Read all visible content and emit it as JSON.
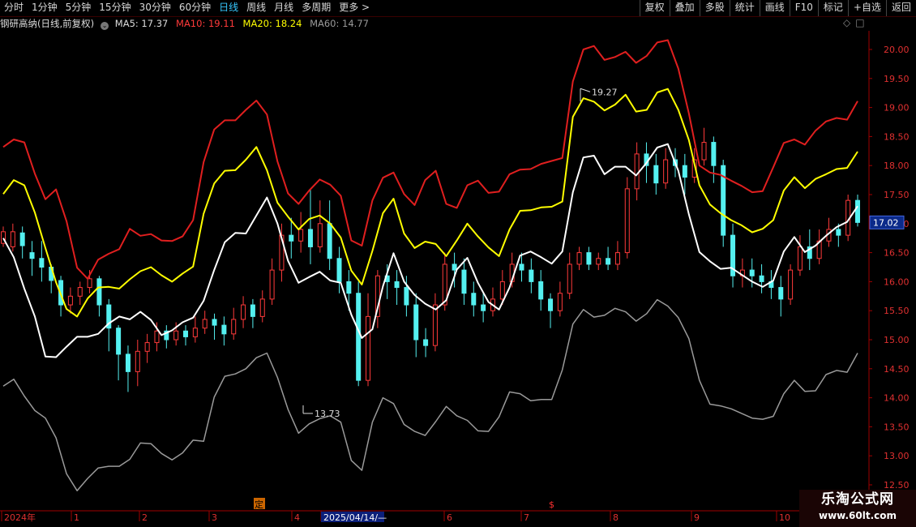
{
  "toolbar": {
    "periods": [
      "分时",
      "1分钟",
      "5分钟",
      "15分钟",
      "30分钟",
      "60分钟",
      "日线",
      "周线",
      "月线",
      "多周期",
      "更多 >"
    ],
    "active_period": "日线",
    "actions": [
      "复权",
      "叠加",
      "多股",
      "统计",
      "画线",
      "F10",
      "标记",
      "+自选",
      "返回"
    ]
  },
  "legend": {
    "stock": "钢研高纳(日线,前复权)",
    "ma5": "MA5: 17.37",
    "ma10": "MA10: 19.11",
    "ma20": "MA20: 18.24",
    "ma60": "MA60: 14.77",
    "icons": [
      "diamond-icon",
      "square-icon"
    ]
  },
  "annotations": {
    "high": "19.27",
    "low": "13.73",
    "last_price": "17.02",
    "event_ding": "定",
    "event_s": "$"
  },
  "watermark": {
    "title": "乐淘公式网",
    "url": "www.60lt.com"
  },
  "colors": {
    "up": "#ff3a3a",
    "down": "#54f0f0",
    "ma5": "#ffffff",
    "ma10": "#e01f1f",
    "ma20": "#ffff00",
    "ma60": "#9a9a9a",
    "axis": "#a00000",
    "active_tab": "#37c8ff"
  },
  "chart_data": {
    "type": "candlestick",
    "y_ticks": [
      "20.00",
      "19.50",
      "19.00",
      "18.50",
      "18.00",
      "17.50",
      "17.00",
      "16.50",
      "16.00",
      "15.50",
      "15.00",
      "14.50",
      "14.00",
      "13.50",
      "13.00",
      "12.50"
    ],
    "ylim": [
      12.5,
      20.4
    ],
    "x_ticks": [
      "2024年",
      "1",
      "2",
      "3",
      "4",
      "2025/04/14/—",
      "6",
      "7",
      "8",
      "9",
      "10"
    ],
    "series": [
      {
        "name": "MA5",
        "style": "white-line",
        "values": [
          16.75,
          16.42,
          15.88,
          15.4,
          14.71,
          14.7,
          14.88,
          15.05,
          15.05,
          15.1,
          15.28,
          15.4,
          15.35,
          15.48,
          15.34,
          15.08,
          15.16,
          15.3,
          15.38,
          15.67,
          16.2,
          16.68,
          16.84,
          16.83,
          17.14,
          17.45,
          17.0,
          16.36,
          15.98,
          16.08,
          16.17,
          16.02,
          15.98,
          15.43,
          15.03,
          15.18,
          15.92,
          16.49,
          16.0,
          15.77,
          15.62,
          15.52,
          15.68,
          16.21,
          16.41,
          15.98,
          15.65,
          15.52,
          15.9,
          16.45,
          16.52,
          16.42,
          16.31,
          16.52,
          17.54,
          18.14,
          18.17,
          17.85,
          17.98,
          17.98,
          17.83,
          18.05,
          18.31,
          18.37,
          17.91,
          17.16,
          16.51,
          16.35,
          16.22,
          16.24,
          16.12,
          16.0,
          15.91,
          16.02,
          16.52,
          16.77,
          16.51,
          16.62,
          16.79,
          16.94,
          17.03,
          17.3
        ]
      },
      {
        "name": "MA10",
        "style": "red-line",
        "values": [
          18.32,
          18.45,
          18.4,
          17.86,
          17.42,
          17.59,
          17.04,
          16.24,
          16.05,
          16.38,
          16.48,
          16.56,
          16.91,
          16.79,
          16.82,
          16.71,
          16.7,
          16.78,
          17.06,
          18.06,
          18.62,
          18.78,
          18.78,
          18.96,
          19.12,
          18.88,
          18.07,
          17.52,
          17.34,
          17.57,
          17.76,
          17.67,
          17.48,
          16.71,
          16.62,
          17.4,
          17.79,
          17.88,
          17.51,
          17.32,
          17.75,
          17.91,
          17.34,
          17.27,
          17.66,
          17.74,
          17.53,
          17.55,
          17.85,
          17.93,
          17.94,
          18.03,
          18.08,
          18.13,
          19.45,
          20.0,
          20.06,
          19.82,
          19.87,
          19.96,
          19.77,
          19.89,
          20.12,
          20.16,
          19.67,
          18.9,
          18.0,
          17.88,
          17.84,
          17.74,
          17.65,
          17.54,
          17.56,
          17.97,
          18.39,
          18.45,
          18.36,
          18.6,
          18.76,
          18.82,
          18.79,
          19.11
        ]
      },
      {
        "name": "MA20",
        "style": "yellow-line",
        "values": [
          17.51,
          17.75,
          17.66,
          17.19,
          16.58,
          15.99,
          15.53,
          15.4,
          15.71,
          15.9,
          15.91,
          15.88,
          16.04,
          16.18,
          16.25,
          16.11,
          16.0,
          16.14,
          16.26,
          17.17,
          17.69,
          17.91,
          17.92,
          18.1,
          18.32,
          17.92,
          17.36,
          17.12,
          16.9,
          17.08,
          17.14,
          17.0,
          16.76,
          16.19,
          15.95,
          16.53,
          17.18,
          17.43,
          16.83,
          16.58,
          16.69,
          16.65,
          16.44,
          16.71,
          17.0,
          16.78,
          16.59,
          16.44,
          16.9,
          17.22,
          17.23,
          17.28,
          17.29,
          17.38,
          18.84,
          19.16,
          19.1,
          18.95,
          19.05,
          19.22,
          18.93,
          18.96,
          19.26,
          19.32,
          18.96,
          18.44,
          17.66,
          17.33,
          17.18,
          17.06,
          16.97,
          16.85,
          16.91,
          17.06,
          17.57,
          17.8,
          17.61,
          17.77,
          17.85,
          17.94,
          17.96,
          18.24
        ]
      },
      {
        "name": "MA60",
        "style": "gray-line",
        "values": [
          14.2,
          14.32,
          14.03,
          13.78,
          13.65,
          13.31,
          12.69,
          12.4,
          12.61,
          12.79,
          12.82,
          12.82,
          12.94,
          13.22,
          13.21,
          13.04,
          12.93,
          13.05,
          13.27,
          13.25,
          14.01,
          14.37,
          14.41,
          14.5,
          14.69,
          14.77,
          14.35,
          13.8,
          13.39,
          13.55,
          13.64,
          13.69,
          13.58,
          12.92,
          12.75,
          13.58,
          14.0,
          13.9,
          13.54,
          13.42,
          13.35,
          13.59,
          13.85,
          13.69,
          13.61,
          13.43,
          13.42,
          13.67,
          14.1,
          14.07,
          13.95,
          13.97,
          13.97,
          14.48,
          15.27,
          15.52,
          15.39,
          15.42,
          15.54,
          15.48,
          15.32,
          15.45,
          15.69,
          15.58,
          15.38,
          15.02,
          14.3,
          13.89,
          13.86,
          13.81,
          13.73,
          13.65,
          13.63,
          13.68,
          14.07,
          14.3,
          14.11,
          14.12,
          14.4,
          14.47,
          14.44,
          14.77
        ]
      }
    ],
    "candles": [
      [
        16.66,
        16.86,
        16.6,
        16.95
      ],
      [
        16.6,
        16.86,
        16.52,
        17.0
      ],
      [
        16.84,
        16.62,
        16.4,
        16.95
      ],
      [
        16.5,
        16.4,
        16.1,
        16.7
      ],
      [
        16.4,
        16.25,
        16.0,
        16.7
      ],
      [
        16.25,
        16.02,
        15.8,
        16.3
      ],
      [
        16.02,
        15.6,
        15.4,
        16.1
      ],
      [
        15.6,
        15.75,
        15.45,
        15.9
      ],
      [
        15.75,
        15.9,
        15.6,
        16.0
      ],
      [
        15.9,
        16.05,
        15.8,
        16.2
      ],
      [
        16.05,
        15.6,
        15.4,
        16.1
      ],
      [
        15.6,
        15.2,
        14.8,
        15.7
      ],
      [
        15.2,
        14.75,
        14.3,
        15.25
      ],
      [
        14.75,
        14.45,
        14.1,
        14.9
      ],
      [
        14.45,
        14.8,
        14.2,
        15.0
      ],
      [
        14.8,
        14.95,
        14.6,
        15.1
      ],
      [
        14.95,
        15.15,
        14.8,
        15.3
      ],
      [
        15.15,
        15.0,
        14.85,
        15.25
      ],
      [
        15.0,
        15.15,
        14.9,
        15.3
      ],
      [
        15.15,
        15.05,
        14.9,
        15.25
      ],
      [
        15.05,
        15.2,
        14.95,
        15.4
      ],
      [
        15.2,
        15.35,
        15.1,
        15.5
      ],
      [
        15.35,
        15.25,
        15.0,
        15.45
      ],
      [
        15.25,
        15.1,
        14.9,
        15.4
      ],
      [
        15.1,
        15.35,
        15.0,
        15.55
      ],
      [
        15.35,
        15.6,
        15.2,
        15.75
      ],
      [
        15.6,
        15.4,
        15.2,
        15.7
      ],
      [
        15.4,
        15.7,
        15.3,
        15.85
      ],
      [
        15.7,
        16.2,
        15.6,
        16.4
      ],
      [
        16.2,
        16.8,
        16.0,
        17.0
      ],
      [
        16.8,
        16.7,
        16.4,
        17.1
      ],
      [
        16.7,
        16.9,
        16.5,
        17.2
      ],
      [
        16.9,
        16.6,
        16.3,
        17.6
      ],
      [
        16.6,
        17.0,
        16.5,
        17.4
      ],
      [
        17.0,
        16.4,
        16.2,
        17.4
      ],
      [
        16.4,
        16.0,
        15.8,
        16.6
      ],
      [
        16.0,
        15.8,
        15.5,
        16.2
      ],
      [
        15.8,
        14.3,
        14.2,
        16.0
      ],
      [
        14.3,
        15.4,
        14.2,
        15.8
      ],
      [
        15.4,
        16.1,
        15.2,
        16.2
      ],
      [
        16.1,
        16.0,
        15.7,
        16.3
      ],
      [
        16.0,
        15.9,
        15.6,
        16.2
      ],
      [
        15.9,
        15.6,
        15.4,
        16.1
      ],
      [
        15.6,
        15.0,
        14.7,
        15.8
      ],
      [
        15.0,
        14.9,
        14.7,
        15.2
      ],
      [
        14.9,
        15.6,
        14.8,
        15.8
      ],
      [
        15.6,
        16.3,
        15.5,
        16.5
      ],
      [
        16.3,
        16.2,
        15.9,
        16.5
      ],
      [
        16.2,
        15.8,
        15.6,
        16.4
      ],
      [
        15.8,
        15.6,
        15.4,
        16.0
      ],
      [
        15.6,
        15.5,
        15.3,
        15.8
      ],
      [
        15.5,
        15.7,
        15.4,
        15.9
      ],
      [
        15.7,
        16.0,
        15.6,
        16.2
      ],
      [
        16.0,
        16.3,
        15.9,
        16.5
      ],
      [
        16.3,
        16.2,
        16.0,
        16.5
      ],
      [
        16.2,
        16.0,
        15.8,
        16.4
      ],
      [
        16.0,
        15.7,
        15.5,
        16.2
      ],
      [
        15.7,
        15.5,
        15.2,
        15.8
      ],
      [
        15.5,
        15.8,
        15.4,
        16.0
      ],
      [
        15.8,
        16.3,
        15.7,
        16.5
      ],
      [
        16.3,
        16.5,
        16.2,
        16.6
      ],
      [
        16.5,
        16.3,
        16.2,
        16.6
      ],
      [
        16.3,
        16.4,
        16.2,
        16.5
      ],
      [
        16.4,
        16.3,
        16.2,
        16.6
      ],
      [
        16.3,
        16.5,
        16.2,
        16.7
      ],
      [
        16.5,
        17.6,
        16.4,
        17.8
      ],
      [
        17.6,
        18.2,
        17.4,
        18.4
      ],
      [
        18.2,
        18.0,
        17.7,
        18.4
      ],
      [
        18.0,
        17.7,
        17.5,
        18.2
      ],
      [
        17.7,
        18.1,
        17.6,
        18.3
      ],
      [
        18.1,
        18.0,
        17.8,
        18.3
      ],
      [
        18.0,
        17.8,
        17.5,
        18.2
      ],
      [
        17.8,
        18.1,
        17.7,
        18.3
      ],
      [
        18.1,
        18.4,
        18.0,
        18.65
      ],
      [
        18.4,
        18.0,
        17.7,
        18.5
      ],
      [
        18.0,
        16.8,
        16.6,
        18.1
      ],
      [
        16.8,
        16.1,
        15.9,
        17.0
      ],
      [
        16.1,
        16.2,
        15.9,
        16.4
      ],
      [
        16.2,
        16.1,
        15.9,
        16.4
      ],
      [
        16.1,
        16.0,
        15.8,
        16.3
      ],
      [
        16.0,
        15.9,
        15.7,
        16.2
      ],
      [
        15.9,
        15.7,
        15.4,
        16.1
      ],
      [
        15.7,
        16.2,
        15.6,
        16.3
      ],
      [
        16.2,
        16.6,
        16.1,
        16.8
      ],
      [
        16.6,
        16.4,
        16.2,
        16.9
      ],
      [
        16.4,
        16.7,
        16.3,
        16.9
      ],
      [
        16.7,
        16.9,
        16.6,
        17.1
      ],
      [
        16.9,
        16.8,
        16.6,
        17.0
      ],
      [
        16.8,
        17.4,
        16.7,
        17.5
      ],
      [
        17.4,
        17.02,
        16.95,
        17.5
      ]
    ],
    "high_marker": 19.27,
    "low_marker": 13.73,
    "last_price": 17.02
  }
}
